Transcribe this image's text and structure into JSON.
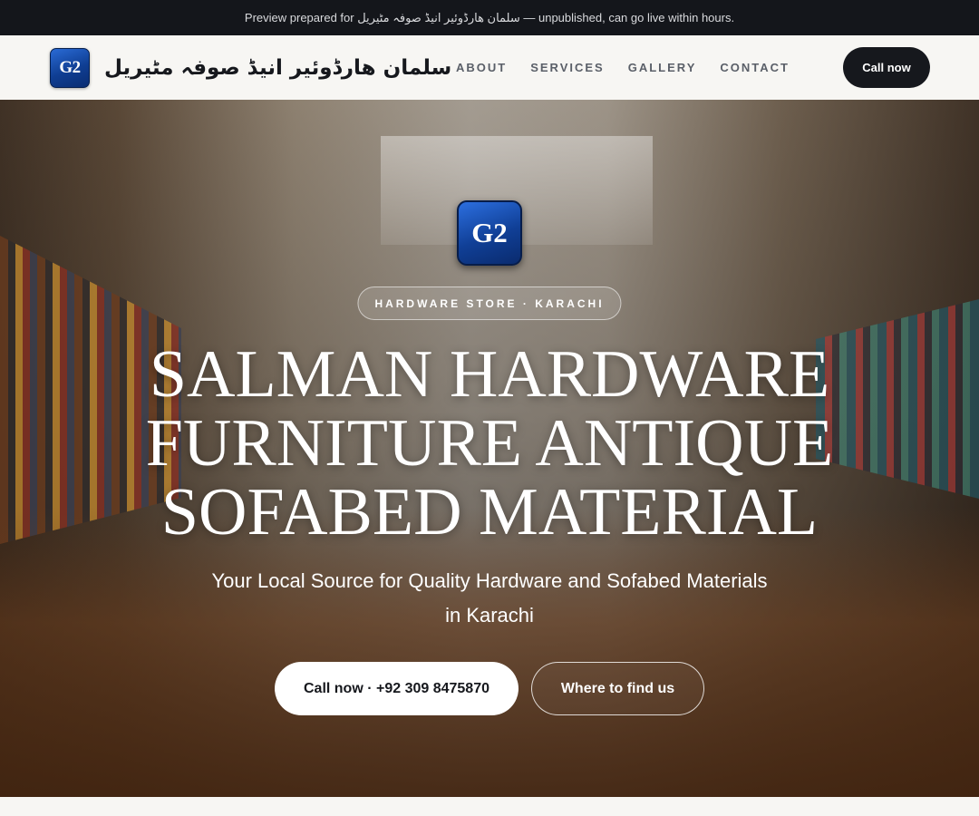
{
  "topbar": {
    "notice": "Preview prepared for سلمان ھارڈوئیر انیڈ صوفہ مٹیریل — unpublished, can go live within hours."
  },
  "nav": {
    "logo_text": "G2",
    "brand_name": "سلمان ھارڈوئیر انیڈ صوفہ مٹیریل",
    "links": [
      "ABOUT",
      "SERVICES",
      "GALLERY",
      "CONTACT"
    ],
    "cta_label": "Call now"
  },
  "hero": {
    "logo_text": "G2",
    "badge": "HARDWARE STORE · KARACHI",
    "headline_lines": [
      "SALMAN HARDWARE",
      "FURNITURE ANTIQUE",
      "SOFABED MATERIAL"
    ],
    "subtitle_lines": [
      "Your Local Source for Quality Hardware and Sofabed Materials",
      "in Karachi"
    ],
    "cta_primary": "Call now · +92 309 8475870",
    "cta_secondary": "Where to find us"
  },
  "colors": {
    "topbar_bg": "#14161b",
    "nav_bg": "#f7f6f3",
    "dark_button": "#16181d",
    "logo_blue": "#103f96"
  },
  "icons": {
    "logo": "g2-logo-badge"
  }
}
